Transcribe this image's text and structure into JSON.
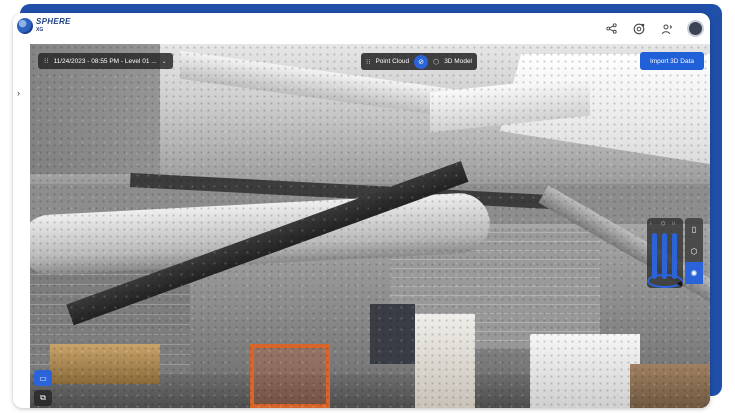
{
  "app": {
    "logo_line1": "SPHERE",
    "logo_line2": "XG"
  },
  "toolbar": {
    "date_label": "11/24/2023 - 08:55 PM - Level 01 ...",
    "mode_left": "Point Cloud",
    "mode_right": "3D Model",
    "import_label": "Import 3D Data"
  },
  "icons": {
    "share": "share-icon",
    "camera": "camera-icon",
    "users": "users-icon",
    "avatar": "avatar"
  }
}
